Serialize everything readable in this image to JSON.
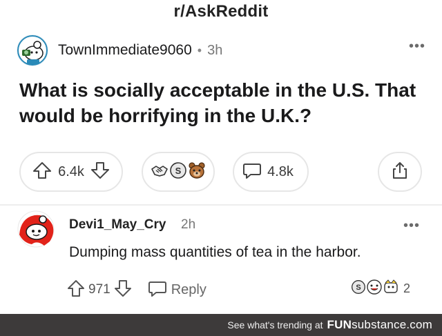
{
  "subreddit": "r/AskReddit",
  "post": {
    "username": "TownImmediate9060",
    "separator": "•",
    "age": "3h",
    "title": "What is socially acceptable in the U.S. That would be horrifying in the U.K.?",
    "score": "6.4k",
    "comments": "4.8k",
    "awards": [
      "handshake-award-icon",
      "silver-award-icon",
      "bear-award-icon"
    ]
  },
  "comment": {
    "username": "Devi1_May_Cry",
    "age": "2h",
    "body": "Dumping mass quantities of tea in the harbor.",
    "score": "971",
    "reply_label": "Reply",
    "award_count": "2"
  },
  "footer": {
    "text": "See what's trending at",
    "brand": "FUN",
    "brand_thin": "substance.com"
  },
  "colors": {
    "reddit_orange": "#ff4500",
    "footer_bg": "#3d3a3a"
  }
}
